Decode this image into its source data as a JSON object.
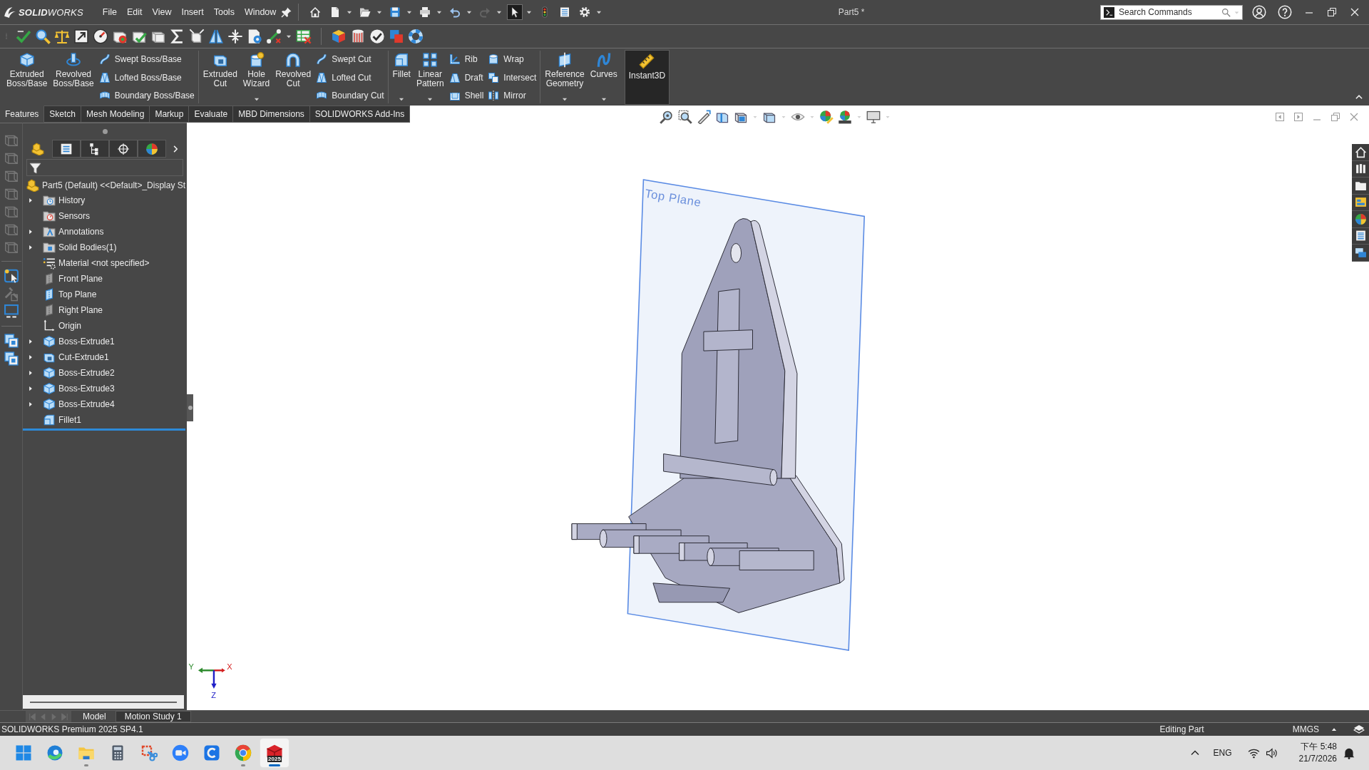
{
  "title_bar": {
    "logo": "**SOLID**WORKS",
    "menus": [
      "File",
      "Edit",
      "View",
      "Insert",
      "Tools",
      "Window"
    ],
    "quick_access": [
      {
        "menu": false,
        "disabled": false,
        "selected": false
      },
      {
        "menu": true,
        "disabled": false,
        "selected": false
      },
      {
        "menu": true,
        "disabled": false,
        "selected": false
      },
      {
        "menu": true,
        "disabled": false,
        "selected": false
      },
      {
        "menu": true,
        "disabled": false,
        "selected": false
      },
      {
        "menu": true,
        "disabled": false,
        "selected": false
      },
      {
        "menu": true,
        "disabled": true,
        "selected": false
      },
      {
        "menu": true,
        "disabled": false,
        "selected": true
      },
      {
        "menu": false,
        "disabled": false,
        "selected": false
      },
      {
        "menu": false,
        "disabled": false,
        "selected": false
      },
      {
        "menu": true,
        "disabled": false,
        "selected": false
      }
    ],
    "document_title": "Part5 *",
    "search": {
      "placeholder": "Search Commands"
    }
  },
  "command_manager": {
    "groups": [
      {
        "items": [
          {
            "kind": "large",
            "label": "Extruded Boss/Base",
            "menu": false
          },
          {
            "kind": "large",
            "label": "Revolved Boss/Base",
            "menu": false
          },
          {
            "kind": "stack",
            "items": [
              "Swept Boss/Base",
              "Lofted Boss/Base",
              "Boundary Boss/Base"
            ]
          }
        ]
      },
      {
        "items": [
          {
            "kind": "large",
            "label": "Extruded Cut",
            "menu": false
          },
          {
            "kind": "large",
            "label": "Hole Wizard",
            "menu": true
          },
          {
            "kind": "large",
            "label": "Revolved Cut",
            "menu": false
          },
          {
            "kind": "stack",
            "items": [
              "Swept Cut",
              "Lofted Cut",
              "Boundary Cut"
            ]
          }
        ]
      },
      {
        "items": [
          {
            "kind": "large",
            "label": "Fillet",
            "menu": true
          },
          {
            "kind": "large",
            "label": "Linear Pattern",
            "menu": true
          },
          {
            "kind": "stack",
            "items": [
              "Rib",
              "Draft",
              "Shell"
            ]
          },
          {
            "kind": "stack",
            "items": [
              "Wrap",
              "Intersect",
              "Mirror"
            ]
          }
        ]
      },
      {
        "items": [
          {
            "kind": "large",
            "label": "Reference Geometry",
            "menu": true
          },
          {
            "kind": "large",
            "label": "Curves",
            "menu": true
          }
        ]
      }
    ],
    "instant3d": {
      "label": "Instant3D",
      "on": true
    },
    "tabs": [
      {
        "label": "Features",
        "selected": true
      },
      {
        "label": "Sketch",
        "selected": false
      },
      {
        "label": "Mesh Modeling",
        "selected": false
      },
      {
        "label": "Markup",
        "selected": false
      },
      {
        "label": "Evaluate",
        "selected": false
      },
      {
        "label": "MBD Dimensions",
        "selected": false
      },
      {
        "label": "SOLIDWORKS Add-Ins",
        "selected": false
      }
    ]
  },
  "feature_manager": {
    "tabs": [
      {
        "selected": true
      },
      {
        "selected": false
      },
      {
        "selected": false
      },
      {
        "selected": false
      },
      {
        "selected": false
      }
    ],
    "tree": {
      "label": "Part5 (Default) <<Default>_Display St",
      "children": [
        {
          "label": "History",
          "expandable": true,
          "shown": true
        },
        {
          "label": "Sensors",
          "expandable": false,
          "shown": true
        },
        {
          "label": "Annotations",
          "expandable": true,
          "shown": true
        },
        {
          "label": "Solid Bodies(1)",
          "expandable": true,
          "shown": true
        },
        {
          "label": "Material <not specified>",
          "expandable": false,
          "shown": true
        },
        {
          "label": "Front Plane",
          "expandable": false,
          "shown": false
        },
        {
          "label": "Top Plane",
          "expandable": false,
          "shown": true
        },
        {
          "label": "Right Plane",
          "expandable": false,
          "shown": false
        },
        {
          "label": "Origin",
          "expandable": false,
          "shown": true
        },
        {
          "label": "Boss-Extrude1",
          "expandable": true,
          "shown": true
        },
        {
          "label": "Cut-Extrude1",
          "expandable": true,
          "shown": true
        },
        {
          "label": "Boss-Extrude2",
          "expandable": true,
          "shown": true
        },
        {
          "label": "Boss-Extrude3",
          "expandable": true,
          "shown": true
        },
        {
          "label": "Boss-Extrude4",
          "expandable": true,
          "shown": true
        },
        {
          "label": "Fillet1",
          "expandable": false,
          "shown": true
        }
      ]
    }
  },
  "graphics_area": {
    "plane_label": "Top Plane",
    "triad": {
      "x": "X",
      "y": "Y",
      "z": "Z"
    }
  },
  "model_tabs": [
    {
      "label": "Model",
      "selected": true
    },
    {
      "label": "Motion Study 1",
      "selected": false
    }
  ],
  "status_bar": {
    "product": "SOLIDWORKS Premium 2025 SP4.1",
    "mode": "Editing Part",
    "units": "MMGS"
  },
  "taskbar": {
    "apps": [
      {
        "running": false,
        "active": false
      },
      {
        "running": false,
        "active": false
      },
      {
        "running": true,
        "active": false
      },
      {
        "running": false,
        "active": false
      },
      {
        "running": false,
        "active": false
      },
      {
        "running": false,
        "active": false
      },
      {
        "running": false,
        "active": false
      },
      {
        "running": true,
        "active": false
      },
      {
        "running": true,
        "active": true,
        "badge": "2025"
      }
    ],
    "language": "ENG",
    "time": "下午 5:48",
    "date": "21/7/2026"
  }
}
